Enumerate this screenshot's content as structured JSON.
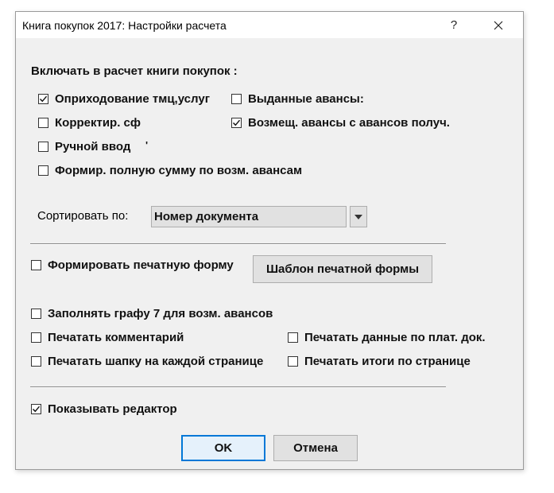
{
  "window": {
    "title": "Книга покупок 2017: Настройки расчета",
    "help_glyph": "?",
    "close_glyph": "✕"
  },
  "section_include": {
    "heading": "Включать в расчет книги покупок   :",
    "options": [
      {
        "label": "Оприходование тмц,услуг",
        "checked": true
      },
      {
        "label": "Выданные авансы:",
        "checked": false
      },
      {
        "label": "Корректир. сф",
        "checked": false
      },
      {
        "label": "Возмещ. авансы с авансов получ.",
        "checked": true
      },
      {
        "label": "Ручной ввод",
        "checked": false
      },
      {
        "label": "Формир. полную сумму  по возм. авансам",
        "checked": false
      }
    ],
    "stray_mark": "'"
  },
  "sort": {
    "label": "Сортировать по:",
    "selected": "Номер документа"
  },
  "print_form": {
    "checkbox_label": "Формировать печатную форму",
    "checked": false,
    "template_button": "Шаблон печатной формы"
  },
  "print_options": [
    {
      "label": "Заполнять графу 7 для возм. авансов",
      "checked": false
    },
    {
      "label": "Печатать комментарий",
      "checked": false
    },
    {
      "label": "Печатать данные по плат. док.",
      "checked": false
    },
    {
      "label": "Печатать шапку на каждой странице",
      "checked": false
    },
    {
      "label": "Печатать итоги по странице",
      "checked": false
    }
  ],
  "show_editor": {
    "label": "Показывать редактор",
    "checked": true
  },
  "buttons": {
    "ok": "OK",
    "cancel": "Отмена"
  }
}
